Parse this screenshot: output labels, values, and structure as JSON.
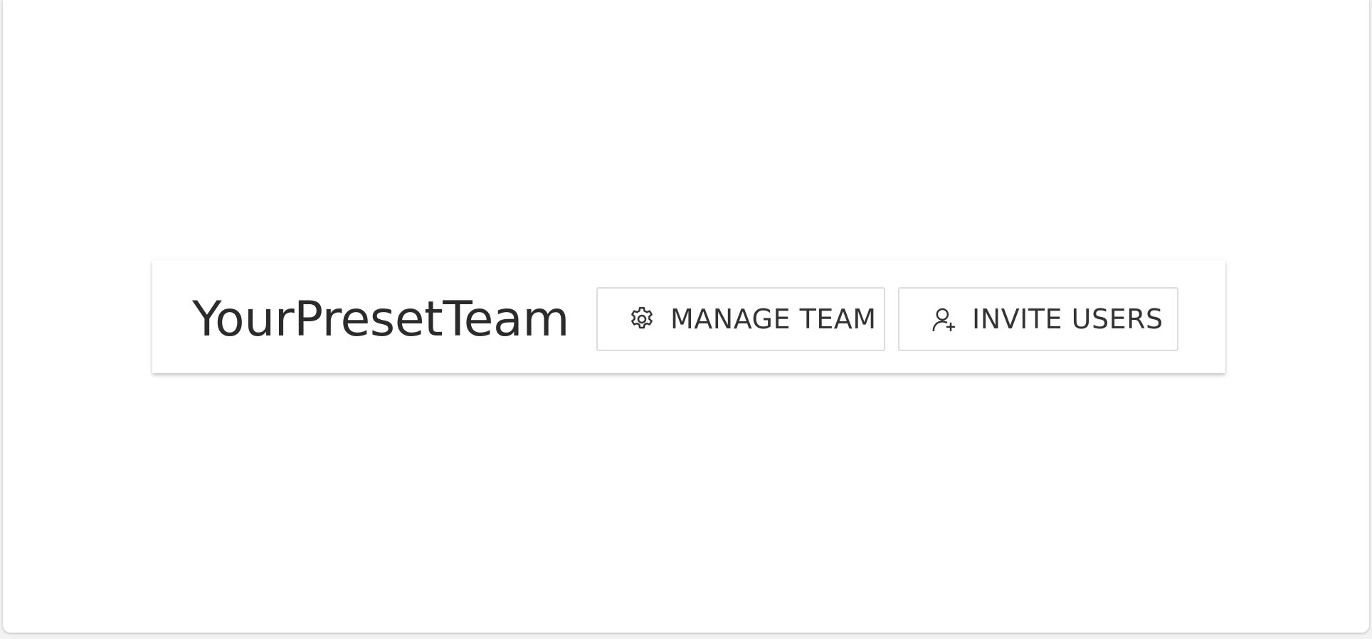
{
  "team_header": {
    "team_name": "YourPresetTeam",
    "buttons": {
      "manage_team": {
        "label": "MANAGE TEAM",
        "icon": "gear-icon"
      },
      "invite_users": {
        "label": "INVITE USERS",
        "icon": "user-plus-icon"
      }
    }
  },
  "colors": {
    "text": "#2b2b2b",
    "button_border": "#dcdcdc",
    "background": "#ffffff"
  }
}
